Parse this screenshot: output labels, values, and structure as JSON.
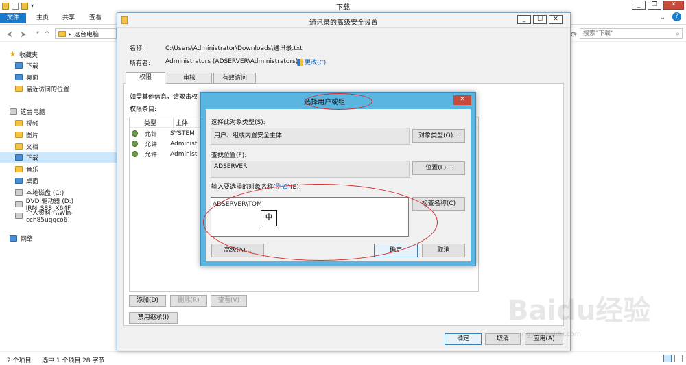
{
  "explorer": {
    "title": "下载",
    "ribbon_tabs": [
      "文件",
      "主页",
      "共享",
      "查看"
    ],
    "breadcrumb": "这台电脑",
    "breadcrumb_chevron": "▸",
    "search_placeholder": "搜索\"下载\"",
    "nav": {
      "favorites": "收藏夹",
      "fav_items": [
        "下载",
        "桌面",
        "最近访问的位置"
      ],
      "this_pc": "这台电脑",
      "pc_items": [
        "视频",
        "图片",
        "文档",
        "下载",
        "音乐",
        "桌面",
        "本地磁盘 (C:)",
        "DVD 驱动器 (D:) IRM_SSS_X64F",
        "个人资料 (\\\\Win-cch85uqqco6)"
      ],
      "network": "网络"
    },
    "status": {
      "items": "2 个项目",
      "selected": "选中 1 个项目",
      "size": "28 字节"
    }
  },
  "advanced": {
    "title": "通讯录的高级安全设置",
    "name_label": "名称:",
    "name_value": "C:\\Users\\Administrator\\Downloads\\通讯录.txt",
    "owner_label": "所有者:",
    "owner_value": "Administrators (ADSERVER\\Administrators)",
    "change_link": "更改(C)",
    "tabs": [
      "权限",
      "审核",
      "有效访问"
    ],
    "info_text": "如需其他信息，请双击权",
    "entries_label": "权限条目:",
    "columns": [
      "类型",
      "主体"
    ],
    "rows": [
      {
        "type": "允许",
        "principal": "SYSTEM"
      },
      {
        "type": "允许",
        "principal": "Administ"
      },
      {
        "type": "允许",
        "principal": "Administ"
      }
    ],
    "buttons": {
      "add": "添加(D)",
      "remove": "删除(R)",
      "view": "查看(V)",
      "disable_inherit": "禁用继承(I)",
      "ok": "确定",
      "cancel": "取消",
      "apply": "应用(A)"
    }
  },
  "select": {
    "title": "选择用户或组",
    "close": "✕",
    "type_label": "选择此对象类型(S):",
    "type_value": "用户、组或内置安全主体",
    "type_btn": "对象类型(O)...",
    "loc_label": "查找位置(F):",
    "loc_value": "ADSERVER",
    "loc_btn": "位置(L)...",
    "name_label_pre": "输入要选择的对象名称(",
    "name_label_link": "例如",
    "name_label_post": ")(E):",
    "name_value": "ADSERVER\\TOM",
    "check_btn": "检查名称(C)",
    "advanced_btn": "高级(A)...",
    "ok_btn": "确定",
    "cancel_btn": "取消",
    "ime": "中"
  },
  "watermark": {
    "main": "Baidu经验",
    "sub": "jingyan.baidu.com"
  }
}
